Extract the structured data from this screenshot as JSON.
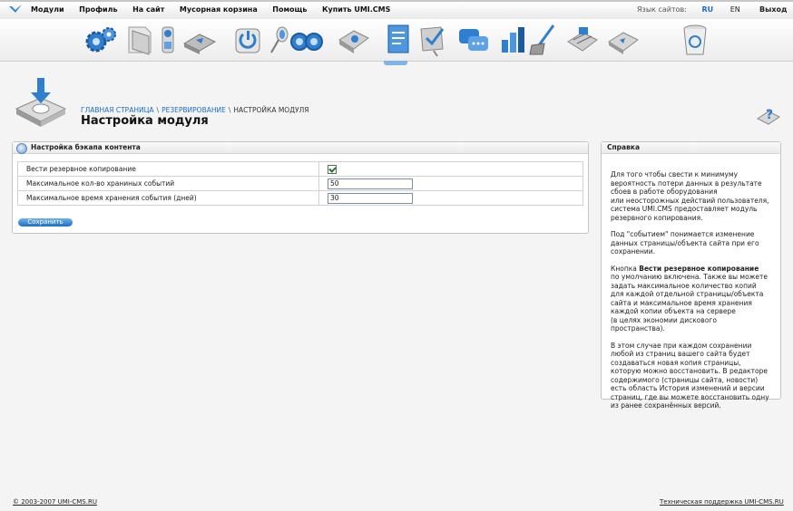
{
  "topmenu": {
    "items": [
      "Модули",
      "Профиль",
      "На сайт",
      "Мусорная корзина",
      "Помощь",
      "Купить UMI.CMS"
    ],
    "lang_label": "Язык сайтов:",
    "lang_ru": "RU",
    "lang_en": "EN",
    "logout": "Выход"
  },
  "module_icons": [
    "settings-icon",
    "pages-icon",
    "users-icon",
    "catalog-icon",
    "backup-icon",
    "microphone-icon",
    "search-binoculars-icon",
    "emarket-icon",
    "news-icon",
    "forms-icon",
    "stats-icon",
    "comments-icon",
    "config-icon",
    "cleaner-icon",
    "webmaster-icon",
    "exchange-icon",
    "trash-icon"
  ],
  "breadcrumb": {
    "home": "Главная страница",
    "section": "Резервирование",
    "current": "Настройка модуля",
    "sep": "\\"
  },
  "page_title": "Настройка модуля",
  "panel": {
    "title": "Настройка бэкапа контента",
    "rows": [
      {
        "label": "Вести резервное копирование",
        "value": ""
      },
      {
        "label": "Максимальное кол-во храниных событий",
        "value": "50"
      },
      {
        "label": "Максимальное время хранения события (дней)",
        "value": "30"
      }
    ],
    "backup_enabled": true,
    "save_label": "Сохранить"
  },
  "help": {
    "title": "Справка",
    "p1": "Для того чтобы свести к минимуму\nвероятность потери данных в результате\nсбоев в работе оборудования\nили неосторожных действий пользователя,\nсистема UMI.CMS предоставляет модуль\nрезервного копирования.",
    "p2": "Под \"событием\" понимается изменение\nданных страницы/объекта сайта при его\nсохранении.",
    "p3_before": "Кнопка ",
    "p3_bold": "Вести резервное копирование",
    "p3_after": "\nпо умолчанию включена. Также вы можете\nзадать максимальное количество копий\nдля каждой отдельной страницы/объекта\nсайта и максимальное время хранения\nкаждой копии объекта на сервере\n(в целях экономии дискового\nпространства).",
    "p4": "В этом случае при каждом сохранении\nлюбой из страниц вашего сайта будет\nсоздаваться новая копия страницы,\nкоторую можно восстановить. В редакторе\nсодержимого (страницы сайта, новости)\nесть область История изменений и версии\nстраниц, где вы можете восстановить одну\nиз ранее сохранённых версий."
  },
  "footer": {
    "copyright": "© 2003-2007 UMI-CMS.RU",
    "support": "Техническая поддержка UMI-CMS.RU"
  }
}
